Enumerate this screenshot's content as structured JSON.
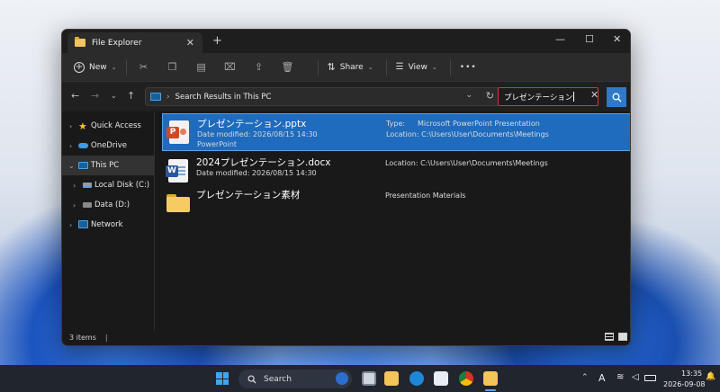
{
  "window": {
    "tab_title": "File Explorer",
    "new_tab": "+",
    "tab_close": "✕",
    "minimize": "—",
    "maximize": "☐",
    "close": "✕"
  },
  "toolbar": {
    "new_label": "New",
    "share_label": "Share",
    "view_label": "View",
    "more_label": "•••"
  },
  "address": {
    "path": "Search Results in This PC",
    "search_value": "プレゼンテーション"
  },
  "sidebar": {
    "items": [
      {
        "label": "Quick Access",
        "icon": "star-icon"
      },
      {
        "label": "OneDrive",
        "icon": "cloud-icon"
      },
      {
        "label": "This PC",
        "icon": "computer-icon"
      },
      {
        "label": "Local Disk (C:)",
        "icon": "drive-icon"
      },
      {
        "label": "Data (D:)",
        "icon": "drive-icon"
      },
      {
        "label": "Network",
        "icon": "network-icon"
      }
    ]
  },
  "files": [
    {
      "name": "プレゼンテーション.pptx",
      "date": "Date modified: 2026/08/15 14:30",
      "app": "PowerPoint",
      "type_label": "Type:",
      "type_value": "Microsoft PowerPoint Presentation",
      "location": "Location: C:\\Users\\User\\Documents\\Meetings",
      "icon": "powerpoint-icon",
      "icon_letter": "P"
    },
    {
      "name": "2024プレゼンテーション.docx",
      "date": "Date modified: 2026/08/15 14:30",
      "location": "Location: C:\\Users\\User\\Documents\\Meetings",
      "icon": "word-icon",
      "icon_letter": "W"
    },
    {
      "name": "プレゼンテーション素材",
      "description": "Presentation Materials",
      "icon": "folder-icon"
    }
  ],
  "status": {
    "count": "3 items",
    "cursor": "|"
  },
  "taskbar": {
    "search_label": "Search",
    "time": "13:35",
    "date": "2026-09-08",
    "input_indicator": "A"
  },
  "colors": {
    "selection": "#1f6bbd",
    "accent": "#2f79c8",
    "search_outline": "#d9362e"
  }
}
